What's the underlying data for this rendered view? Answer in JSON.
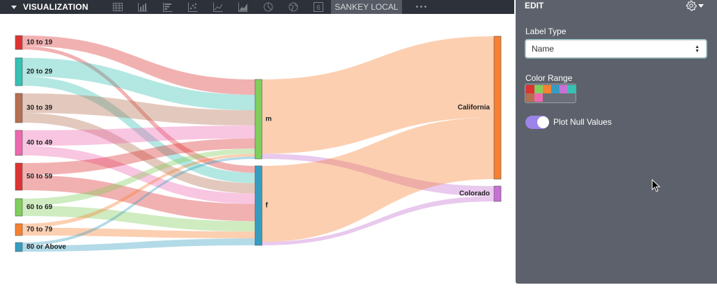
{
  "toolbar": {
    "title": "VISUALIZATION",
    "icons": [
      "table-icon",
      "column-chart-icon",
      "bar-chart-icon",
      "scatter-icon",
      "line-chart-icon",
      "area-chart-icon",
      "pie-chart-icon",
      "map-icon",
      "single-value-icon"
    ],
    "single_value_glyph": "6",
    "active_tab": "SANKEY LOCAL",
    "more": "more-icon"
  },
  "edit_panel": {
    "title": "EDIT",
    "label_type_label": "Label Type",
    "label_type_value": "Name",
    "color_range_label": "Color Range",
    "color_range": [
      "#dd3333",
      "#80ce5d",
      "#f78131",
      "#369dc1",
      "#c572d3",
      "#36c1b3",
      "#b57052",
      "#ed69af"
    ],
    "plot_null_label": "Plot Null Values",
    "plot_null_enabled": true,
    "accent_color": "#9c84e8"
  },
  "chart_data": {
    "type": "sankey",
    "source_nodes": [
      {
        "name": "10 to 19",
        "color": "#dd3333"
      },
      {
        "name": "20 to 29",
        "color": "#36c1b3"
      },
      {
        "name": "30 to 39",
        "color": "#b57052"
      },
      {
        "name": "40 to 49",
        "color": "#ed69af"
      },
      {
        "name": "50 to 59",
        "color": "#dd3333"
      },
      {
        "name": "60 to 69",
        "color": "#80ce5d"
      },
      {
        "name": "70 to 79",
        "color": "#f78131"
      },
      {
        "name": "80 or Above",
        "color": "#369dc1"
      }
    ],
    "middle_nodes": [
      {
        "name": "m",
        "color": "#80ce5d"
      },
      {
        "name": "f",
        "color": "#369dc1"
      }
    ],
    "target_nodes": [
      {
        "name": "California",
        "color": "#f78131"
      },
      {
        "name": "Colorado",
        "color": "#c572d3"
      }
    ],
    "links": [
      {
        "source": "10 to 19",
        "target": "m",
        "value": 6
      },
      {
        "source": "10 to 19",
        "target": "f",
        "value": 2
      },
      {
        "source": "20 to 29",
        "target": "m",
        "value": 6
      },
      {
        "source": "20 to 29",
        "target": "f",
        "value": 3
      },
      {
        "source": "30 to 39",
        "target": "m",
        "value": 6
      },
      {
        "source": "30 to 39",
        "target": "f",
        "value": 3
      },
      {
        "source": "40 to 49",
        "target": "m",
        "value": 5
      },
      {
        "source": "40 to 49",
        "target": "f",
        "value": 3
      },
      {
        "source": "50 to 59",
        "target": "m",
        "value": 4
      },
      {
        "source": "50 to 59",
        "target": "f",
        "value": 5
      },
      {
        "source": "60 to 69",
        "target": "m",
        "value": 2
      },
      {
        "source": "60 to 69",
        "target": "f",
        "value": 3
      },
      {
        "source": "70 to 79",
        "target": "m",
        "value": 1
      },
      {
        "source": "70 to 79",
        "target": "f",
        "value": 2
      },
      {
        "source": "80 or Above",
        "target": "m",
        "value": 1
      },
      {
        "source": "80 or Above",
        "target": "f",
        "value": 2
      },
      {
        "source": "m",
        "target": "California",
        "value": 29
      },
      {
        "source": "m",
        "target": "Colorado",
        "value": 2
      },
      {
        "source": "f",
        "target": "California",
        "value": 22
      },
      {
        "source": "f",
        "target": "Colorado",
        "value": 1
      }
    ]
  }
}
